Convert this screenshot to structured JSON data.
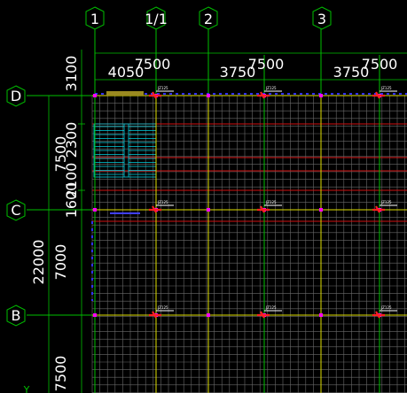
{
  "canvas": {
    "background": "#000000",
    "grid_color": "#7f7f7f",
    "axis_line_color": "#00ff00",
    "beam_color": "#ffff00",
    "wall_color": "#ff0000",
    "accent_magenta": "#ff00ff",
    "stair_color": "#00ffff"
  },
  "axes": {
    "columns": [
      {
        "label": "1"
      },
      {
        "label": "1/1"
      },
      {
        "label": "2"
      },
      {
        "label": "3"
      }
    ],
    "rows": [
      {
        "label": "D"
      },
      {
        "label": "C"
      },
      {
        "label": "B"
      }
    ]
  },
  "dimensions": {
    "top_total_1": "7500",
    "top_total_2": "7500",
    "top_total_3": "7500",
    "top_sub_1": "4050",
    "top_sub_2": "3750",
    "top_sub_3": "3750",
    "top_offset": "3100",
    "left_total": "22000",
    "left_span_dc": "7500",
    "left_span_cb": "7000",
    "left_span_b": "7500",
    "left_stack_1": "2300",
    "left_stack_2": "2100",
    "left_stack_3": "1600"
  },
  "symbols": {
    "column_tag": "JZ125"
  },
  "ucs": {
    "y_label": "Y"
  }
}
